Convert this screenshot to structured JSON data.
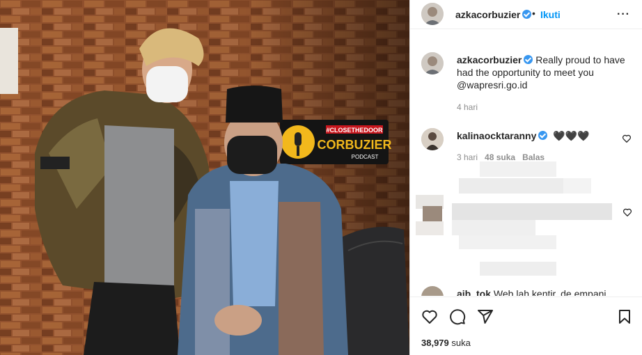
{
  "post": {
    "author": "azkacorbuzier",
    "dot": "•",
    "follow_label": "Ikuti",
    "more_label": "···"
  },
  "photo": {
    "sign_line1": "#CLOSETHEDOOR",
    "sign_line2": "CORBUZIER",
    "sign_line3": "PODCAST"
  },
  "caption": {
    "author": "azkacorbuzier",
    "text": "Really proud to have had the opportunity to meet you @wapresri.go.id",
    "time": "4 hari"
  },
  "comment": {
    "author": "kalinaocktaranny",
    "text": "🖤🖤🖤",
    "time": "3 hari",
    "likes": "48 suka",
    "reply": "Balas"
  },
  "cut_comment": {
    "author": "aib_tok",
    "text": "Web lah kentir, de empani"
  },
  "stats": {
    "likes_count": "38,979",
    "likes_label": "suka"
  },
  "colors": {
    "accent": "#0095f6",
    "verified": "#3897f0",
    "muted": "#8e8e8e"
  },
  "icons": [
    "heart-icon",
    "comment-icon",
    "share-icon",
    "bookmark-icon",
    "more-icon",
    "verified-icon"
  ]
}
